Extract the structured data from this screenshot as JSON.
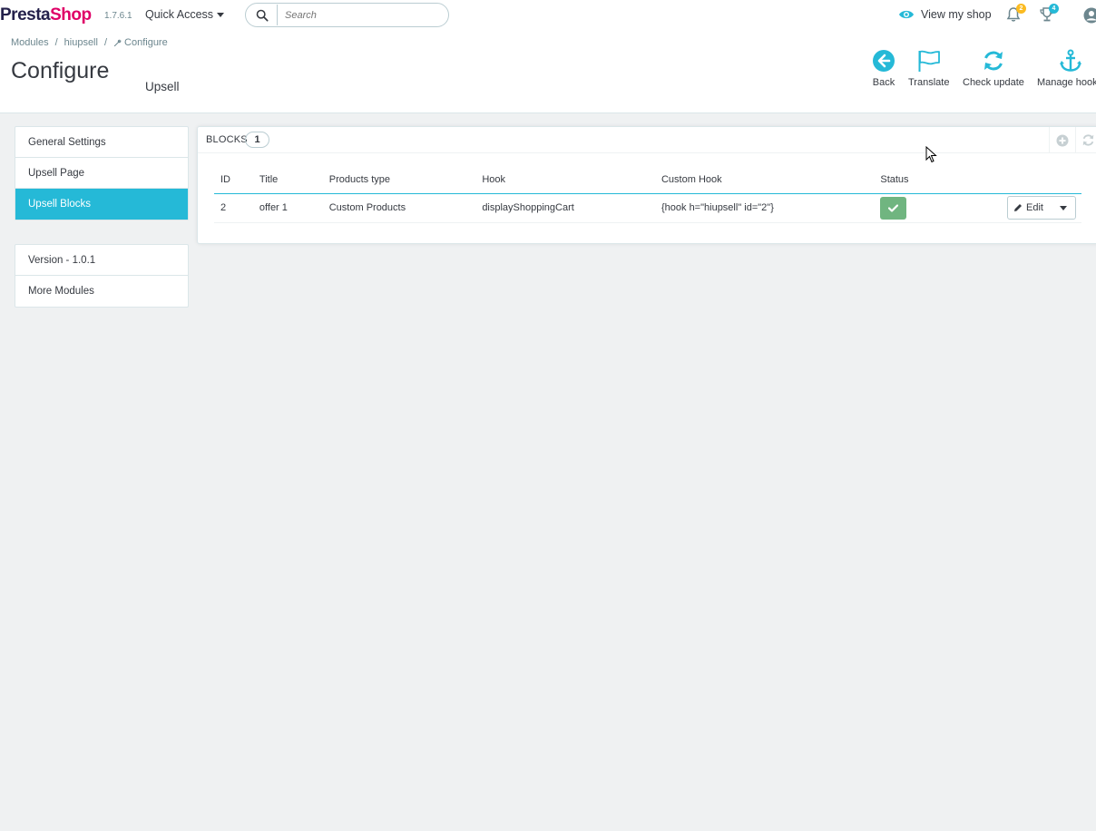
{
  "topbar": {
    "logo_part1": "Presta",
    "logo_part2": "Shop",
    "version": "1.7.6.1",
    "quick_access": "Quick Access",
    "search_placeholder": "Search",
    "view_shop": "View my shop",
    "notifications_count": "2",
    "trophy_count": "4"
  },
  "breadcrumb": {
    "items": [
      "Modules",
      "hiupsell",
      "Configure"
    ]
  },
  "header": {
    "title": "Configure",
    "subtitle": "Upsell",
    "toolbar": {
      "back": "Back",
      "translate": "Translate",
      "check_update": "Check update",
      "manage_hooks": "Manage hooks"
    }
  },
  "sidebar": {
    "items": [
      {
        "label": "General Settings"
      },
      {
        "label": "Upsell Page"
      },
      {
        "label": "Upsell Blocks"
      }
    ],
    "footer_items": [
      {
        "label": "Version - 1.0.1"
      },
      {
        "label": "More Modules"
      }
    ]
  },
  "blocks_panel": {
    "title": "Blocks",
    "count": "1",
    "columns": [
      "ID",
      "Title",
      "Products type",
      "Hook",
      "Custom Hook",
      "Status"
    ],
    "rows": [
      {
        "id": "2",
        "title": "offer 1",
        "products_type": "Custom Products",
        "hook": "displayShoppingCart",
        "custom_hook": "{hook h=\"hiupsell\" id=\"2\"}",
        "status": "enabled",
        "edit_label": "Edit"
      }
    ]
  },
  "colors": {
    "accent": "#25b9d7",
    "brand_pink": "#df0067",
    "brand_dark": "#24214b",
    "success": "#70b580",
    "notification_badge": "#fbbb22",
    "trophy_badge": "#25b9d7"
  }
}
